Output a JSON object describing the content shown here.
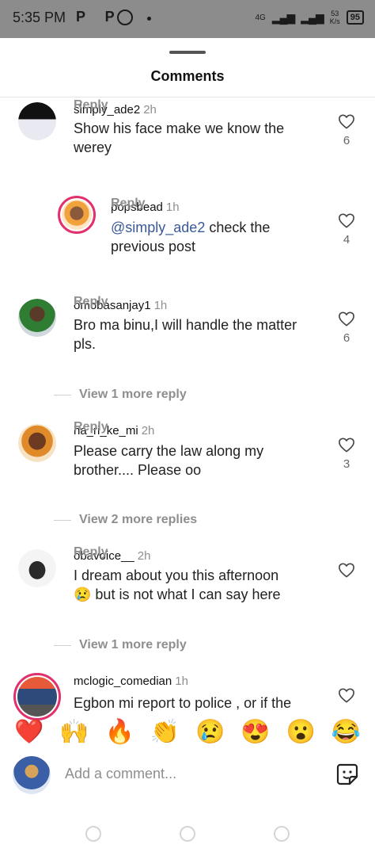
{
  "status_bar": {
    "time": "5:35 PM",
    "app_icons": "P P",
    "whatsapp_icon": "whatsapp-icon",
    "network": "4G",
    "speed_value": "53",
    "speed_unit": "K/s",
    "battery": "95"
  },
  "sheet": {
    "title": "Comments"
  },
  "comments": [
    {
      "username": "simply_ade2",
      "time": "2h",
      "text": "Show his face make we know the werey",
      "reply": "Reply",
      "likes": "6"
    },
    {
      "username": "popsbead",
      "time": "1h",
      "mention": "@simply_ade2",
      "text": " check the previous post",
      "reply": "Reply",
      "likes": "4"
    },
    {
      "username": "omobasanjay1",
      "time": "1h",
      "text": "Bro ma binu,I will handle the matter pls.",
      "reply": "Reply",
      "likes": "6",
      "view_more": "View 1 more reply"
    },
    {
      "username": "ha_ri_ke_mi",
      "time": "2h",
      "text": "Please carry the law along my brother.... Please oo",
      "reply": "Reply",
      "likes": "3",
      "view_more": "View 2 more replies"
    },
    {
      "username": "obavoice__",
      "time": "2h",
      "text_line1": "I dream about you this afternoon",
      "emoji": "😢",
      "text_line2": " but is not what I can say here",
      "reply": "Reply",
      "view_more": "View 1 more reply"
    },
    {
      "username": "mclogic_comedian",
      "time": "1h",
      "text": "Egbon mi report to police , or if the"
    }
  ],
  "reactions": [
    "❤️",
    "🙌",
    "🔥",
    "👏",
    "😢",
    "😍",
    "😮",
    "😂"
  ],
  "composer": {
    "placeholder": "Add a comment..."
  },
  "colors": {
    "accent_ring": "#e1306c",
    "mention": "#385898",
    "status_bar": "#8c8c8c"
  }
}
